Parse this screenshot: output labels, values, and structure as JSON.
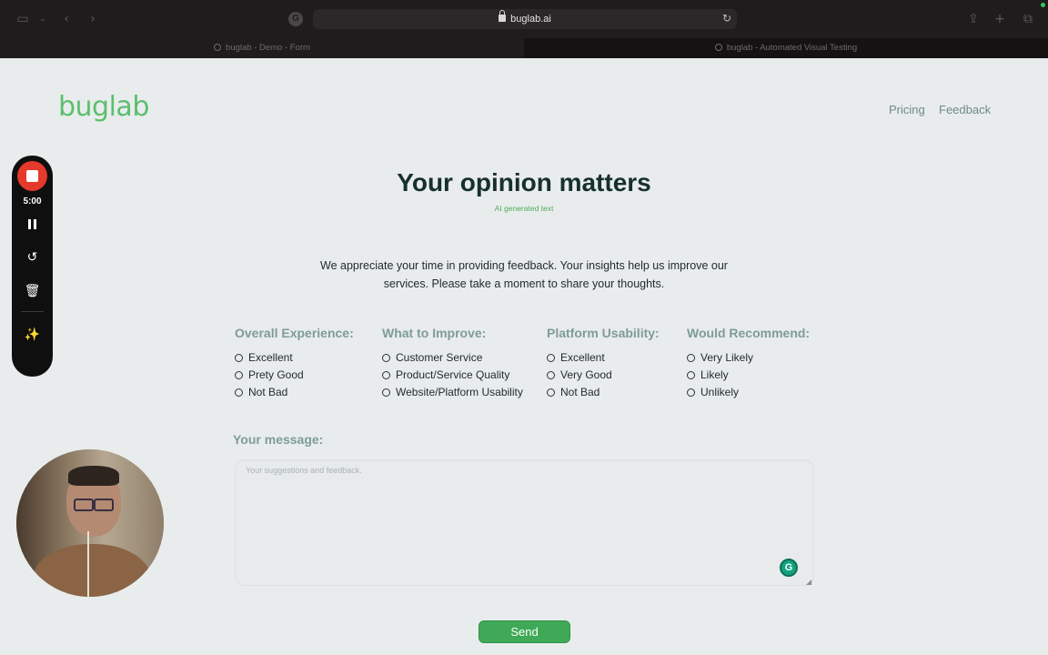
{
  "browser": {
    "url": "buglab.ai",
    "tabs": [
      {
        "title": "buglab - Demo - Form",
        "active": false
      },
      {
        "title": "buglab - Automated Visual Testing",
        "active": true
      }
    ]
  },
  "site": {
    "logo": "buglab",
    "nav": [
      {
        "label": "Pricing"
      },
      {
        "label": "Feedback"
      }
    ]
  },
  "main": {
    "title": "Your opinion matters",
    "ai_note": "AI generated text",
    "intro": "We appreciate your time in providing feedback. Your insights help us improve our services. Please take a moment to share your thoughts.",
    "groups": [
      {
        "title": "Overall Experience:",
        "options": [
          "Excellent",
          "Prety Good",
          "Not Bad"
        ]
      },
      {
        "title": "What to Improve:",
        "options": [
          "Customer Service",
          "Product/Service Quality",
          "Website/Platform Usability"
        ]
      },
      {
        "title": "Platform Usability:",
        "options": [
          "Excellent",
          "Very Good",
          "Not Bad"
        ]
      },
      {
        "title": "Would Recommend:",
        "options": [
          "Very Likely",
          "Likely",
          "Unlikely"
        ]
      }
    ],
    "message_label": "Your message:",
    "message_placeholder": "Your suggestions and feedback.",
    "message_value": "",
    "send_label": "Send"
  },
  "recorder": {
    "time": "5:00"
  },
  "colors": {
    "accent_green": "#3fa957",
    "heading_muted": "#7e9c98",
    "record_red": "#e5392c"
  }
}
